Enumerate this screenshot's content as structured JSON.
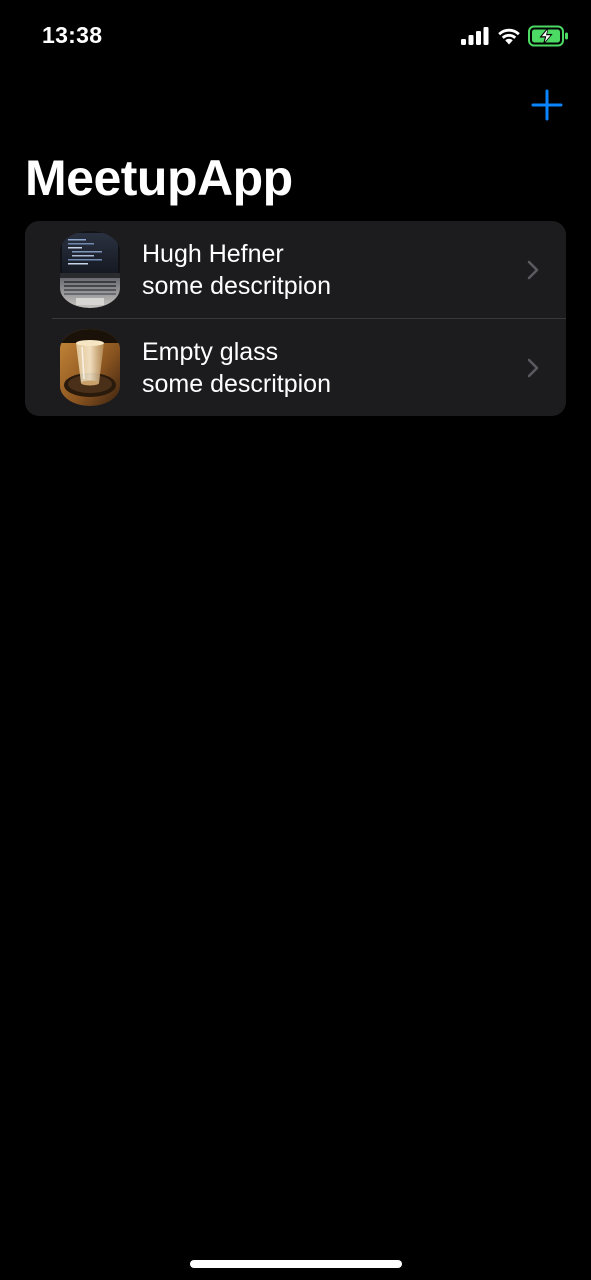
{
  "status_bar": {
    "time": "13:38",
    "signal_icon": "cellular-signal-icon",
    "wifi_icon": "wifi-icon",
    "battery_icon": "battery-charging-icon",
    "battery_color": "#4cd964"
  },
  "nav": {
    "add_icon": "plus-icon",
    "accent_color": "#0a84ff"
  },
  "page": {
    "title": "MeetupApp"
  },
  "meetups": [
    {
      "title": "Hugh Hefner",
      "description": "some descritpion",
      "image": "laptop-photo"
    },
    {
      "title": "Empty glass",
      "description": "some descritpion",
      "image": "glass-photo"
    }
  ]
}
